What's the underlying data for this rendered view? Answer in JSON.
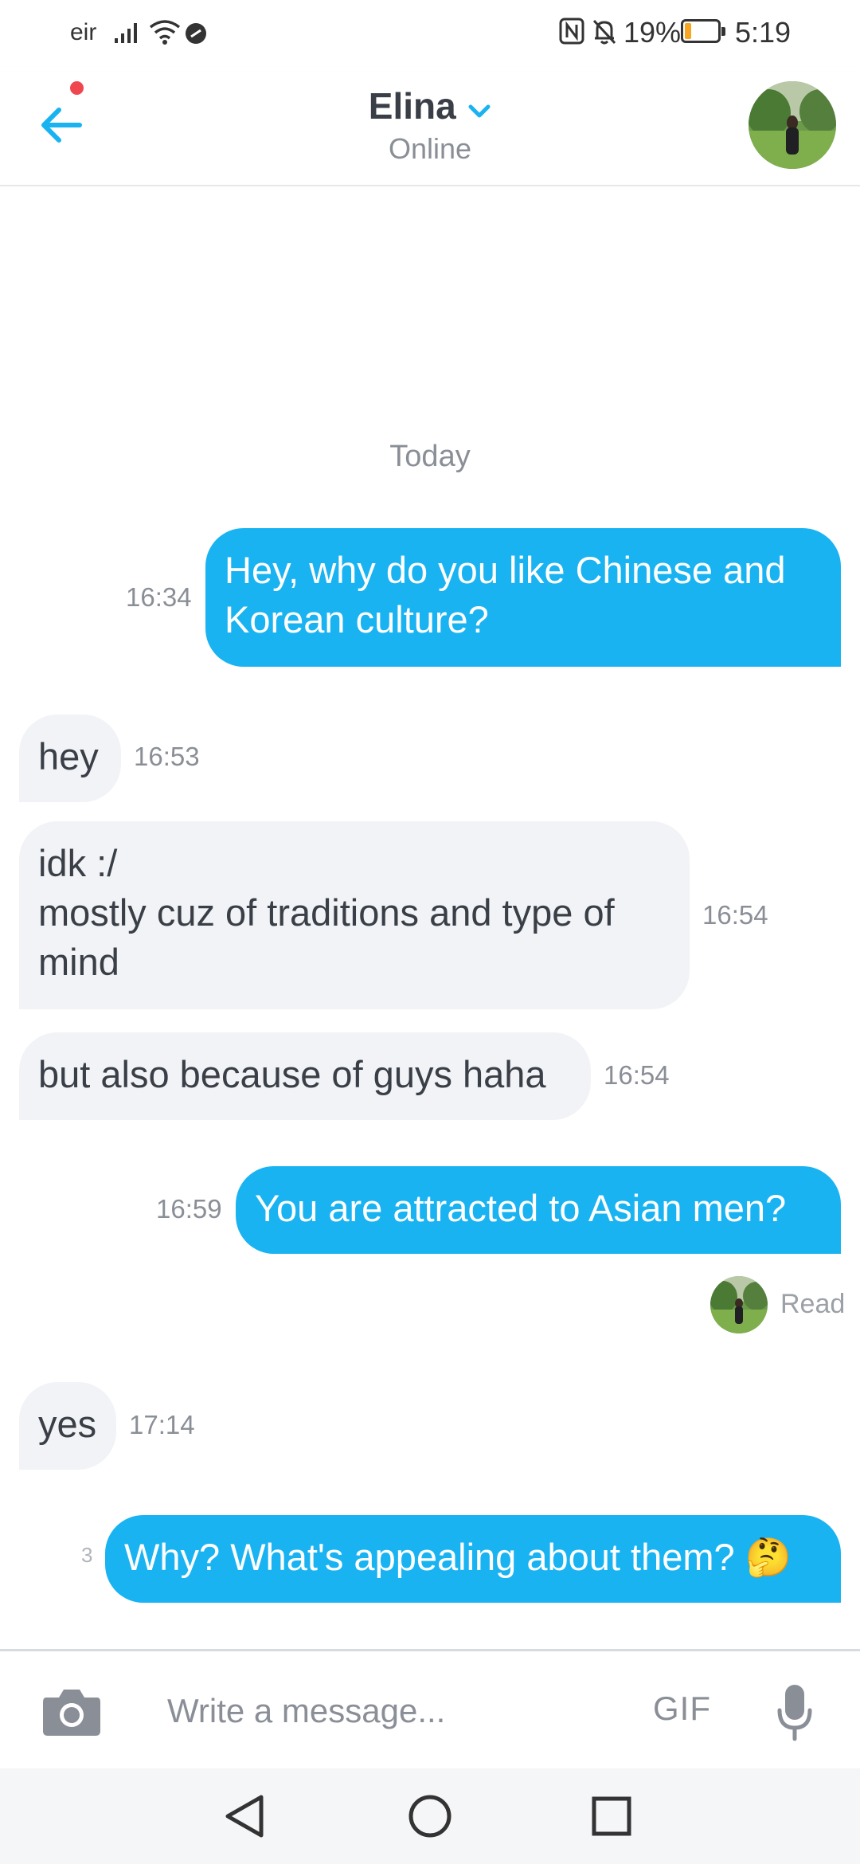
{
  "status_bar": {
    "carrier": "eir",
    "battery_text": "19%",
    "battery_level": 0.19,
    "time": "5:19"
  },
  "header": {
    "contact_name": "Elina",
    "contact_status": "Online",
    "has_notification": true
  },
  "chat": {
    "date_separator": "Today",
    "messages": [
      {
        "direction": "out",
        "text": "Hey, why do you like Chinese and\nKorean culture?",
        "time": "16:34"
      },
      {
        "direction": "in",
        "text": "hey",
        "time": "16:53"
      },
      {
        "direction": "in",
        "text": "idk :/\nmostly cuz of traditions and type of\nmind",
        "time": "16:54"
      },
      {
        "direction": "in",
        "text": "but also because of guys haha",
        "time": "16:54"
      },
      {
        "direction": "out",
        "text": "You are attracted to Asian men?",
        "time": "16:59"
      },
      {
        "direction": "in",
        "text": "yes",
        "time": "17:14"
      },
      {
        "direction": "out",
        "text": "Why? What's appealing about them? 🤔",
        "time": "3"
      }
    ],
    "read_label": "Read"
  },
  "composer": {
    "placeholder": "Write a message...",
    "gif_label": "GIF"
  },
  "colors": {
    "accent": "#1ab3f2",
    "incoming_bubble": "#f1f3f6",
    "notification": "#f0464f",
    "battery": "#f5a623"
  }
}
